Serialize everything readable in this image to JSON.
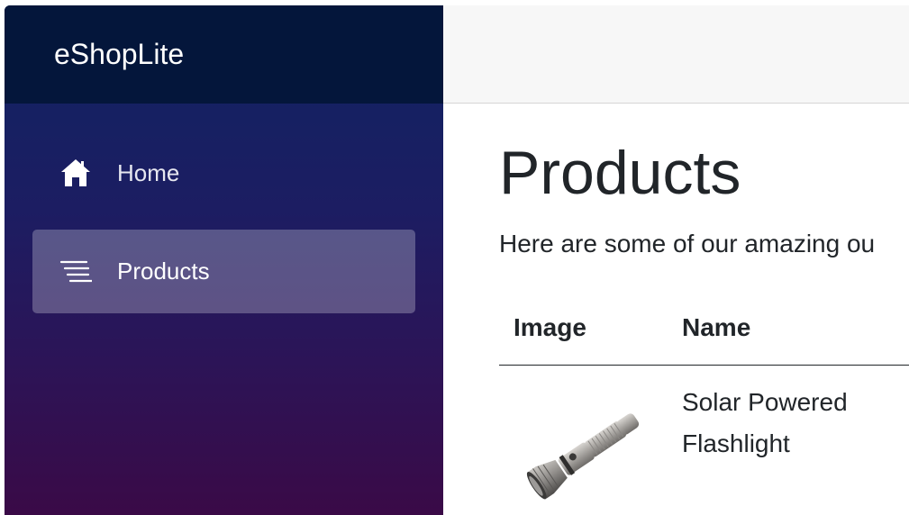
{
  "brand": "eShopLite",
  "nav": {
    "items": [
      {
        "label": "Home",
        "icon": "home-icon",
        "active": false
      },
      {
        "label": "Products",
        "icon": "list-icon",
        "active": true
      }
    ]
  },
  "main": {
    "title": "Products",
    "intro": "Here are some of our amazing ou",
    "table": {
      "headers": [
        "Image",
        "Name"
      ],
      "rows": [
        {
          "image": "flashlight-image",
          "name": "Solar Powered Flashlight"
        }
      ]
    }
  },
  "colors": {
    "sidebar_top": "#04163b",
    "sidebar_gradient_start": "#0f2462",
    "sidebar_gradient_end": "#3a0a47",
    "topbar": "#f7f7f7",
    "text": "#212529"
  }
}
